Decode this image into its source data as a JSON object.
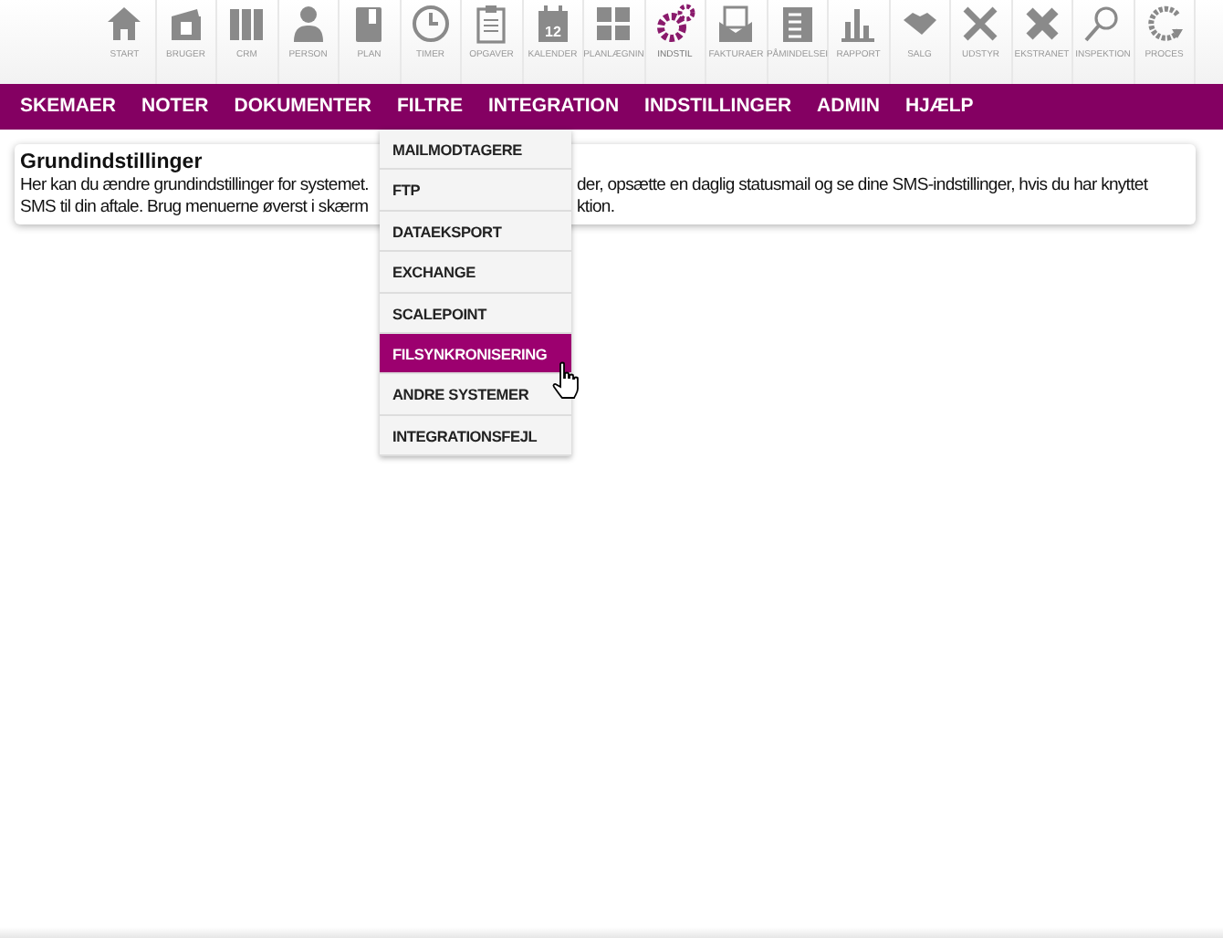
{
  "toolbar": [
    {
      "label": "START",
      "selected": false
    },
    {
      "label": "BRUGER",
      "selected": false
    },
    {
      "label": "CRM",
      "selected": false
    },
    {
      "label": "PERSON",
      "selected": false
    },
    {
      "label": "PLAN",
      "selected": false
    },
    {
      "label": "TIMER",
      "selected": false
    },
    {
      "label": "OPGAVER",
      "selected": false
    },
    {
      "label": "KALENDER",
      "selected": false,
      "icon_text": "12"
    },
    {
      "label": "PLANLÆGNIN",
      "selected": false
    },
    {
      "label": "INDSTIL",
      "selected": true
    },
    {
      "label": "FAKTURAER",
      "selected": false
    },
    {
      "label": "PÅMINDELSEI",
      "selected": false
    },
    {
      "label": "RAPPORT",
      "selected": false
    },
    {
      "label": "SALG",
      "selected": false
    },
    {
      "label": "UDSTYR",
      "selected": false
    },
    {
      "label": "EKSTRANET",
      "selected": false
    },
    {
      "label": "INSPEKTION",
      "selected": false
    },
    {
      "label": "PROCES",
      "selected": false
    }
  ],
  "menu": [
    {
      "label": "SKEMAER"
    },
    {
      "label": "NOTER"
    },
    {
      "label": "DOKUMENTER"
    },
    {
      "label": "FILTRE"
    },
    {
      "label": "INTEGRATION"
    },
    {
      "label": "INDSTILLINGER"
    },
    {
      "label": "ADMIN"
    },
    {
      "label": "HJÆLP"
    }
  ],
  "dropdown": [
    {
      "label": "MAILMODTAGERE",
      "selected": false
    },
    {
      "label": "FTP",
      "selected": false
    },
    {
      "label": "DATAEKSPORT",
      "selected": false
    },
    {
      "label": "EXCHANGE",
      "selected": false
    },
    {
      "label": "SCALEPOINT",
      "selected": false
    },
    {
      "label": "FILSYNKRONISERING",
      "selected": true
    },
    {
      "label": "ANDRE SYSTEMER",
      "selected": false
    },
    {
      "label": "INTEGRATIONSFEJL",
      "selected": false
    }
  ],
  "info": {
    "title": "Grundindstillinger",
    "lines": [
      {
        "left": "Her kan du ændre grundindstillinger for systemet.",
        "right": "der, opsætte en daglig statusmail og se dine SMS-indstillinger, hvis du har knyttet"
      },
      {
        "left": "SMS til din aftale. Brug menuerne øverst i skærm",
        "right": "ktion."
      }
    ]
  }
}
